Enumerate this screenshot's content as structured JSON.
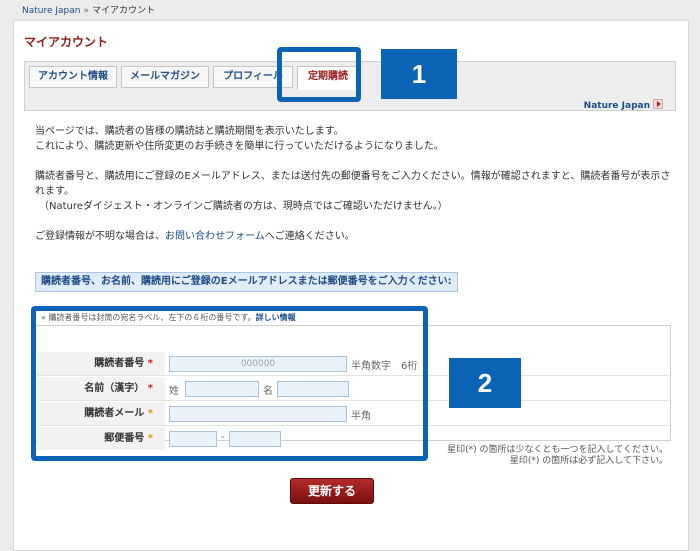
{
  "breadcrumb": {
    "home": "Nature Japan",
    "separator": "»",
    "current": "マイアカウント"
  },
  "page_title": "マイアカウント",
  "tabs": [
    {
      "label": "アカウント情報"
    },
    {
      "label": "メールマガジン"
    },
    {
      "label": "プロフィール"
    },
    {
      "label": "定期購読",
      "active": true
    }
  ],
  "nature_link": "Nature Japan",
  "intro": {
    "line1": "当ページでは、購読者の皆様の購読誌と購読期間を表示いたします。",
    "line2": "これにより、購読更新や住所変更のお手続きを簡単に行っていただけるようになりました。",
    "line3": "購読者番号と、購読用にご登録のEメールアドレス、または送付先の郵便番号をご入力ください。情報が確認されますと、購読者番号が表示されます。",
    "line4": "（Natureダイジェスト・オンラインご購読者の方は、現時点ではご確認いただけません。）",
    "line5_pre": "ご登録情報が不明な場合は、",
    "line5_link": "お問い合わせフォーム",
    "line5_post": "へご連絡ください。"
  },
  "notice": "購読者番号、お名前、購読用にご登録のEメールアドレスまたは郵便番号をご入力ください:",
  "hint": {
    "text": "» 購読者番号は封筒の宛名ラベル、左下の６桁の番号です。",
    "link": "詳しい情報"
  },
  "form": {
    "subscriber_number": {
      "label": "購読者番号",
      "required": "*",
      "placeholder": "000000",
      "note": "半角数字　6桁"
    },
    "name": {
      "label": "名前（漢字）",
      "required": "*",
      "sei": "姓",
      "mei": "名"
    },
    "email": {
      "label": "購読者メール",
      "required": "*",
      "note": "半角"
    },
    "postal": {
      "label": "郵便番号",
      "required": "*",
      "dash": "-"
    }
  },
  "legend": {
    "line1": "星印(*) の箇所は少なくとも一つを記入してください。",
    "line2": "星印(*) の箇所は必ず記入して下さい。"
  },
  "submit_label": "更新する",
  "callouts": {
    "one": "1",
    "two": "2"
  },
  "colors": {
    "accent_blue": "#0a63b4",
    "brand_red": "#8e1a1a"
  }
}
